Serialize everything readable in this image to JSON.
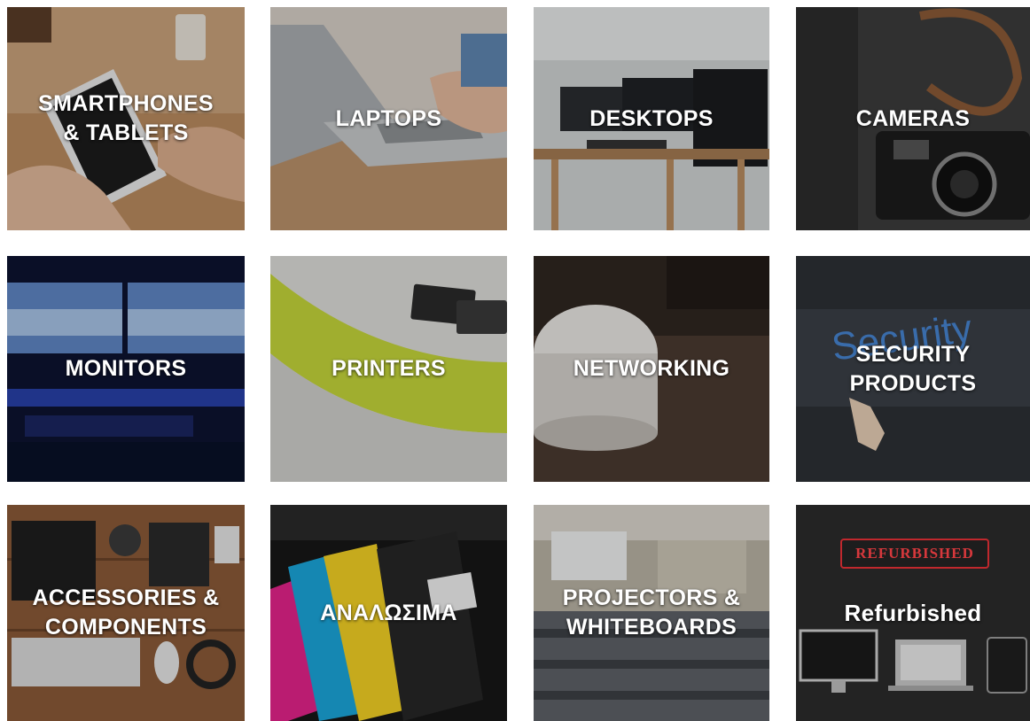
{
  "categories": [
    {
      "id": "smartphones",
      "label": "SMARTPHONES\n& TABLETS"
    },
    {
      "id": "laptops",
      "label": "LAPTOPS"
    },
    {
      "id": "desktops",
      "label": "DESKTOPS"
    },
    {
      "id": "cameras",
      "label": "CAMERAS"
    },
    {
      "id": "monitors",
      "label": "MONITORS"
    },
    {
      "id": "printers",
      "label": "PRINTERS"
    },
    {
      "id": "networking",
      "label": "NETWORKING"
    },
    {
      "id": "security",
      "label": "SECURITY\nPRODUCTS",
      "image_text": "Security"
    },
    {
      "id": "accessories",
      "label": "ACCESSORIES &\nCOMPONENTS"
    },
    {
      "id": "consumables",
      "label": "ΑΝΑΛΩΣΙΜΑ"
    },
    {
      "id": "projectors",
      "label": "PROJECTORS &\nWHITEBOARDS"
    },
    {
      "id": "refurbished",
      "label": "Refurbished",
      "stamp": "REFURBISHED"
    }
  ]
}
